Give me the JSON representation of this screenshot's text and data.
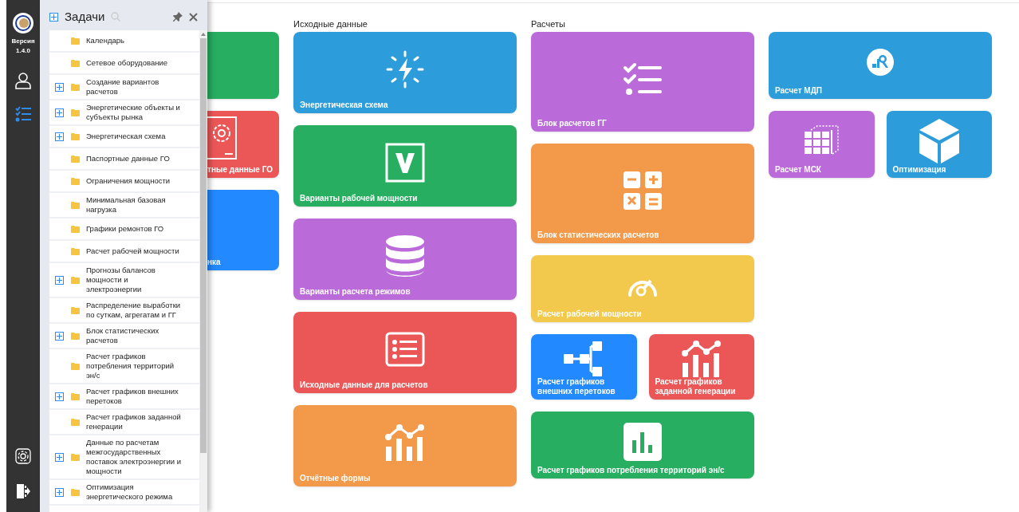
{
  "rail": {
    "version_label": "Версия",
    "version": "1.4.0",
    "nav": [
      {
        "selected": false
      },
      {
        "selected": true
      }
    ]
  },
  "tasks_panel": {
    "title": "Задачи",
    "items": [
      {
        "label": "Календарь",
        "kind": "leaf"
      },
      {
        "label": "Сетевое оборудование",
        "kind": "leaf"
      },
      {
        "label": "Создание вариантов расчетов",
        "kind": "group"
      },
      {
        "label": "Энергетические объекты и субъекты рынка",
        "kind": "group"
      },
      {
        "label": "Энергетическая схема",
        "kind": "group"
      },
      {
        "label": "Паспортные данные ГО",
        "kind": "leaf"
      },
      {
        "label": "Ограничения мощности",
        "kind": "leaf"
      },
      {
        "label": "Минимальная базовая нагрузка",
        "kind": "leaf"
      },
      {
        "label": "Графики ремонтов ГО",
        "kind": "leaf"
      },
      {
        "label": "Расчет рабочей мощности",
        "kind": "leaf"
      },
      {
        "label": "Прогнозы балансов мощности и электроэнергии",
        "kind": "group"
      },
      {
        "label": "Распределение выработки по суткам, агрегатам и ГГ",
        "kind": "leaf"
      },
      {
        "label": "Блок статистических расчетов",
        "kind": "group"
      },
      {
        "label": "Расчет графиков потребления территорий эн/с",
        "kind": "leaf"
      },
      {
        "label": "Расчет графиков внешних перетоков",
        "kind": "group"
      },
      {
        "label": "Расчет графиков заданной генерации",
        "kind": "leaf"
      },
      {
        "label": "Данные по расчетам межгосударственных поставок электроэнергии и мощности",
        "kind": "group"
      },
      {
        "label": "Оптимизация энергетического режима",
        "kind": "group"
      }
    ]
  },
  "columns": [
    {
      "rows": [
        [
          {
            "color": "#27ae60"
          }
        ],
        [
          {
            "label": "тные данные ГО",
            "color": "#eb5757"
          }
        ],
        [
          {
            "label": "нка",
            "color": "#2289ff"
          }
        ]
      ]
    },
    {
      "heading": "Исходные данные",
      "rows": [
        [
          {
            "label": "Энергетическая схема",
            "color": "#2d9cdb"
          }
        ],
        [
          {
            "label": "Варианты рабочей мощности",
            "color": "#27ae60"
          }
        ],
        [
          {
            "label": "Варианты расчета режимов",
            "color": "#bb6bd9"
          }
        ],
        [
          {
            "label": "Исходные данные для расчетов",
            "color": "#eb5757"
          }
        ],
        [
          {
            "label": "Отчётные формы",
            "color": "#f2994a"
          }
        ]
      ]
    },
    {
      "heading": "Расчеты",
      "rows": [
        [
          {
            "label": "Блок расчетов ГГ",
            "color": "#bb6bd9"
          }
        ],
        [
          {
            "label": "Блок статистических расчетов",
            "color": "#f2994a"
          }
        ],
        [
          {
            "label": "Расчет рабочей мощности",
            "color": "#f2c94c"
          }
        ],
        [
          {
            "label": "Расчет графиков внешних перетоков",
            "color": "#2289ff"
          },
          {
            "label": "Расчет графиков заданной генерации",
            "color": "#eb5757"
          }
        ],
        [
          {
            "label": "Расчет графиков потребления территорий эн/с",
            "color": "#27ae60"
          }
        ]
      ]
    },
    {
      "rows": [
        [
          {
            "label": "Расчет МДП",
            "color": "#2d9cdb"
          }
        ],
        [
          {
            "label": "Расчет МСК",
            "color": "#bb6bd9"
          },
          {
            "label": "Оптимизация",
            "color": "#2d9cdb"
          }
        ]
      ]
    }
  ]
}
